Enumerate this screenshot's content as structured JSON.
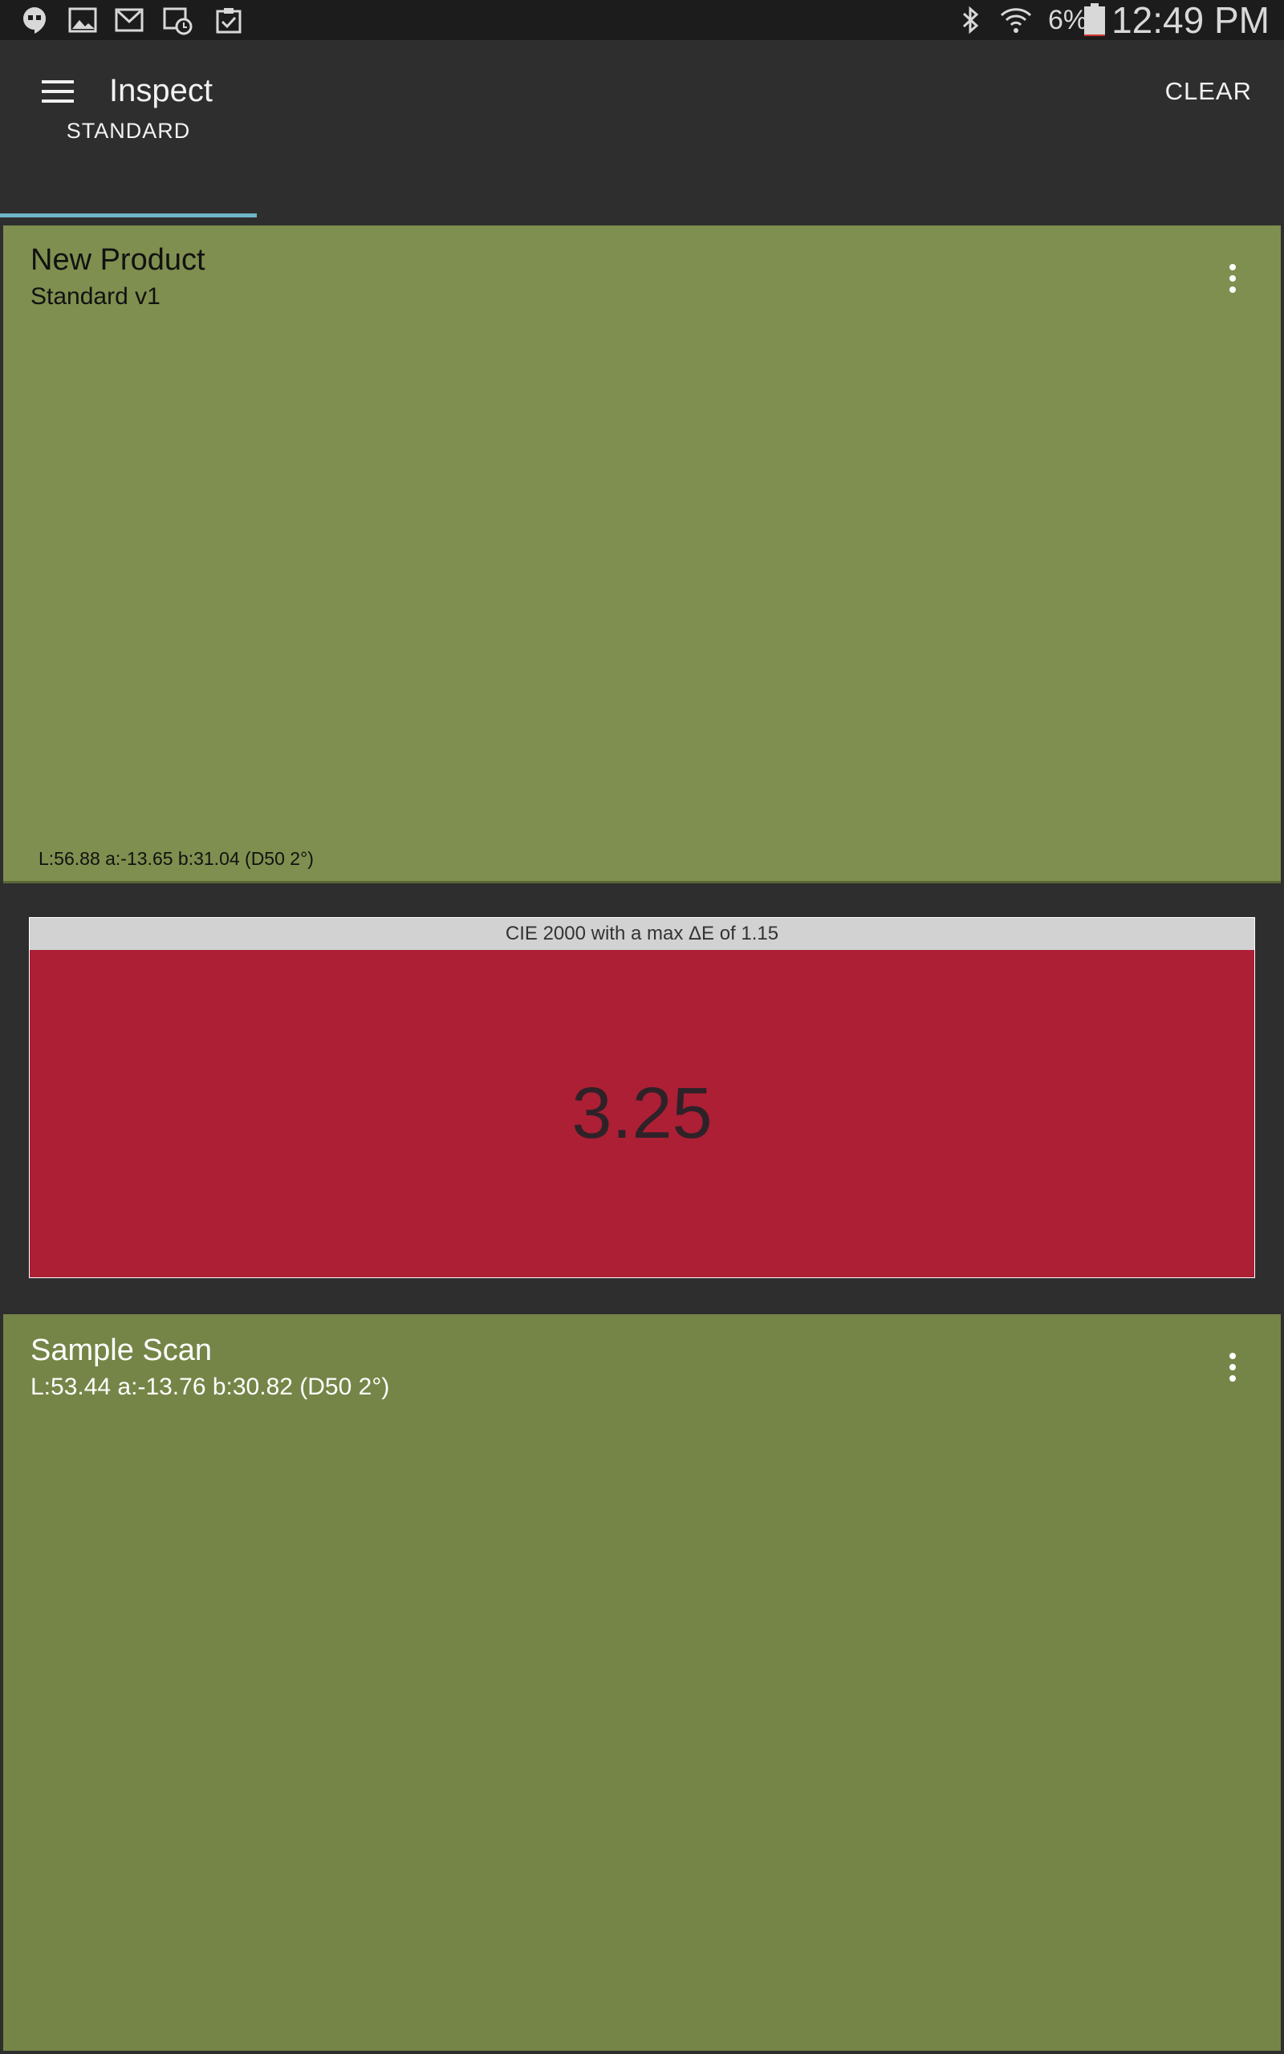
{
  "status_bar": {
    "battery_percent": "6%",
    "time": "12:49 PM",
    "battery_level": 0.06,
    "icons": [
      "hangouts-icon",
      "gallery-icon",
      "gmail-icon",
      "calendar-clock-icon",
      "clipboard-check-icon",
      "bluetooth-icon",
      "wifi-icon",
      "battery-icon"
    ]
  },
  "app_bar": {
    "title": "Inspect",
    "clear_label": "CLEAR"
  },
  "tabs": [
    {
      "label": "STANDARD",
      "active": true
    }
  ],
  "standard_card": {
    "title": "New Product",
    "subtitle": "Standard v1",
    "lab": "L:56.88 a:-13.65 b:31.04 (D50 2°)",
    "swatch_color": "#7f8f4f"
  },
  "delta_e": {
    "header": "CIE 2000 with a max ΔE of 1.15",
    "value": "3.25",
    "fail_color": "#ac1f35"
  },
  "sample_card": {
    "title": "Sample Scan",
    "lab": "L:53.44 a:-13.76 b:30.82 (D50 2°)",
    "swatch_color": "#758547"
  },
  "colors": {
    "tab_indicator": "#6fb6c8",
    "background": "#2e2e2e"
  }
}
